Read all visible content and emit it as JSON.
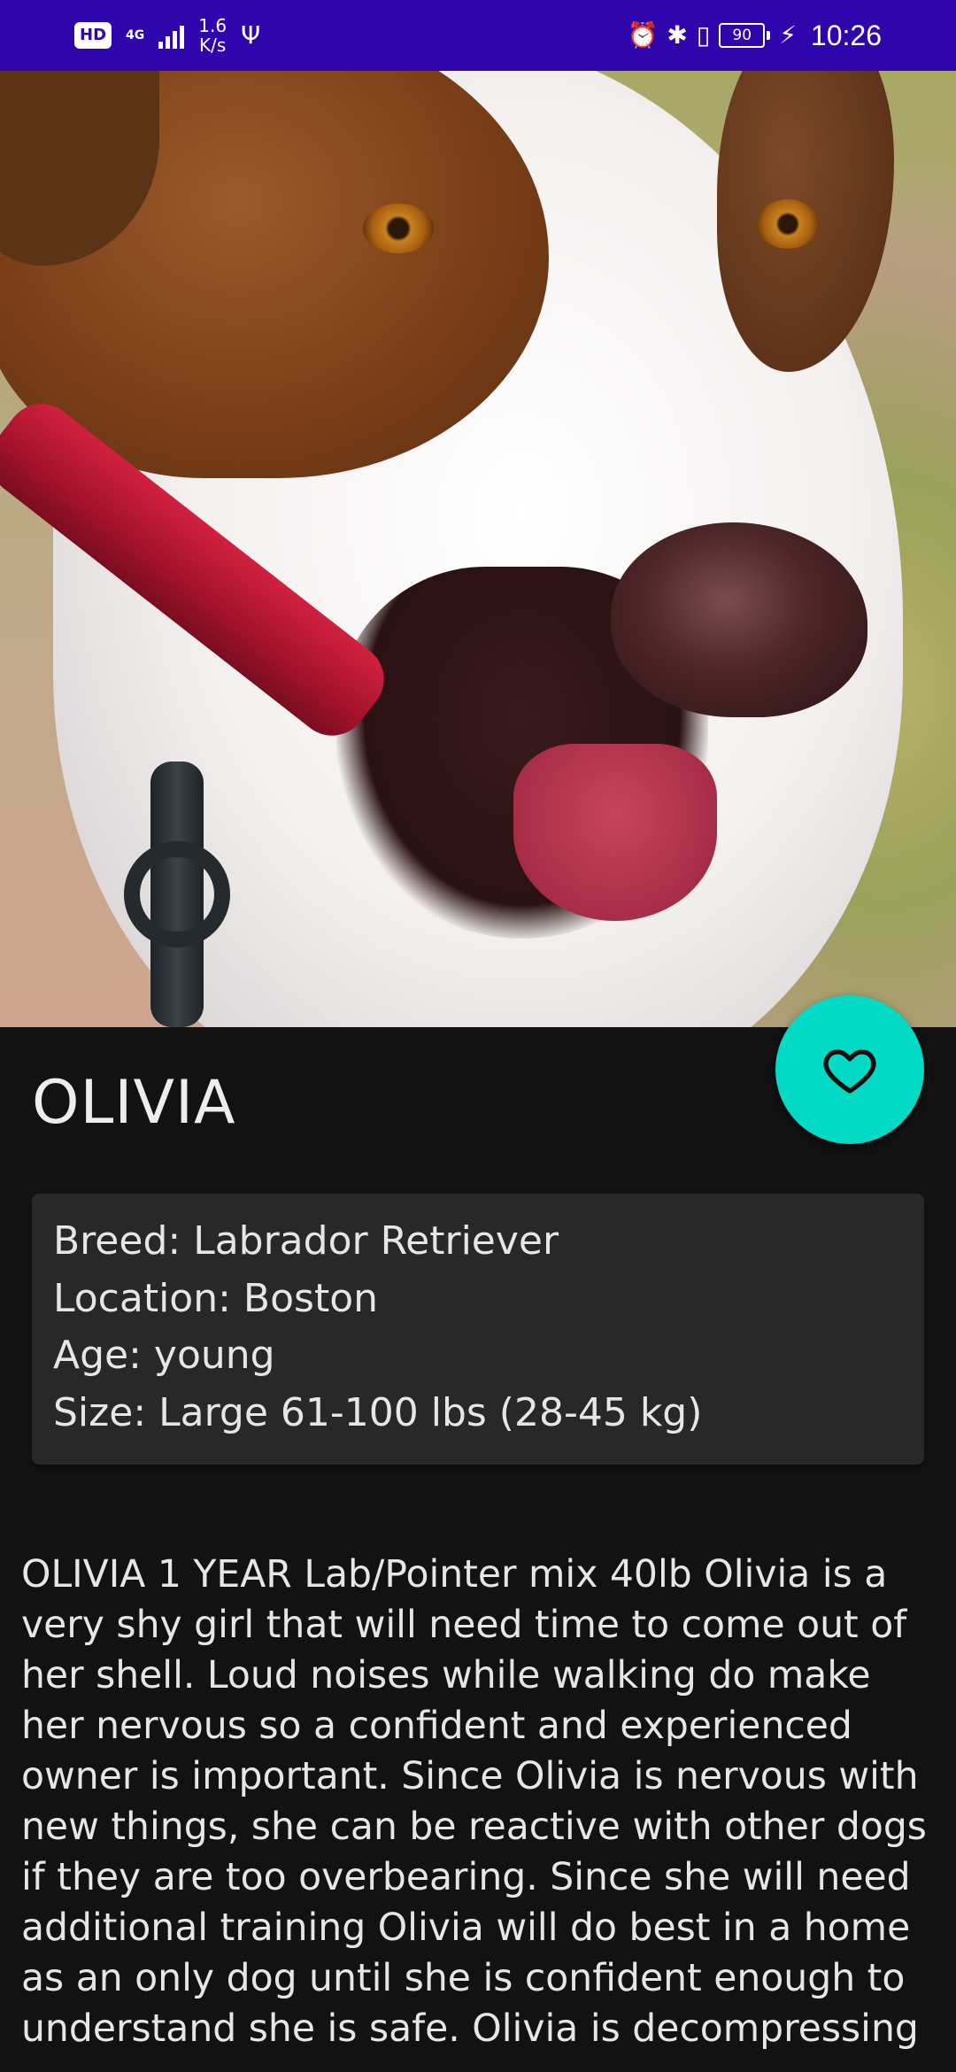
{
  "status_bar": {
    "hd": "HD",
    "network": "4G",
    "speed_value": "1.6",
    "speed_unit": "K/s",
    "battery": "90",
    "time": "10:26"
  },
  "pet": {
    "name": "OLIVIA",
    "favorite_icon": "heart-outline-icon",
    "details": {
      "breed": "Breed: Labrador Retriever",
      "location": "Location: Boston",
      "age": "Age: young",
      "size": "Size: Large 61-100 lbs (28-45 kg)"
    },
    "description": "OLIVIA 1 YEAR Lab/Pointer mix 40lb  Olivia is a very shy girl that will need time to come out of her shell. Loud noises while walking do make her nervous so a confident and experienced owner is important. Since Olivia is nervous with new things, she can be reactive with other dogs if they are too overbearing. Since she will need additional training Olivia will do best in a home as an only dog until she is confident enough to understand she is safe. Olivia is decompressing"
  },
  "colors": {
    "status_bar": "#2e06ab",
    "background": "#121212",
    "card": "#282828",
    "fab": "#03dac5"
  }
}
